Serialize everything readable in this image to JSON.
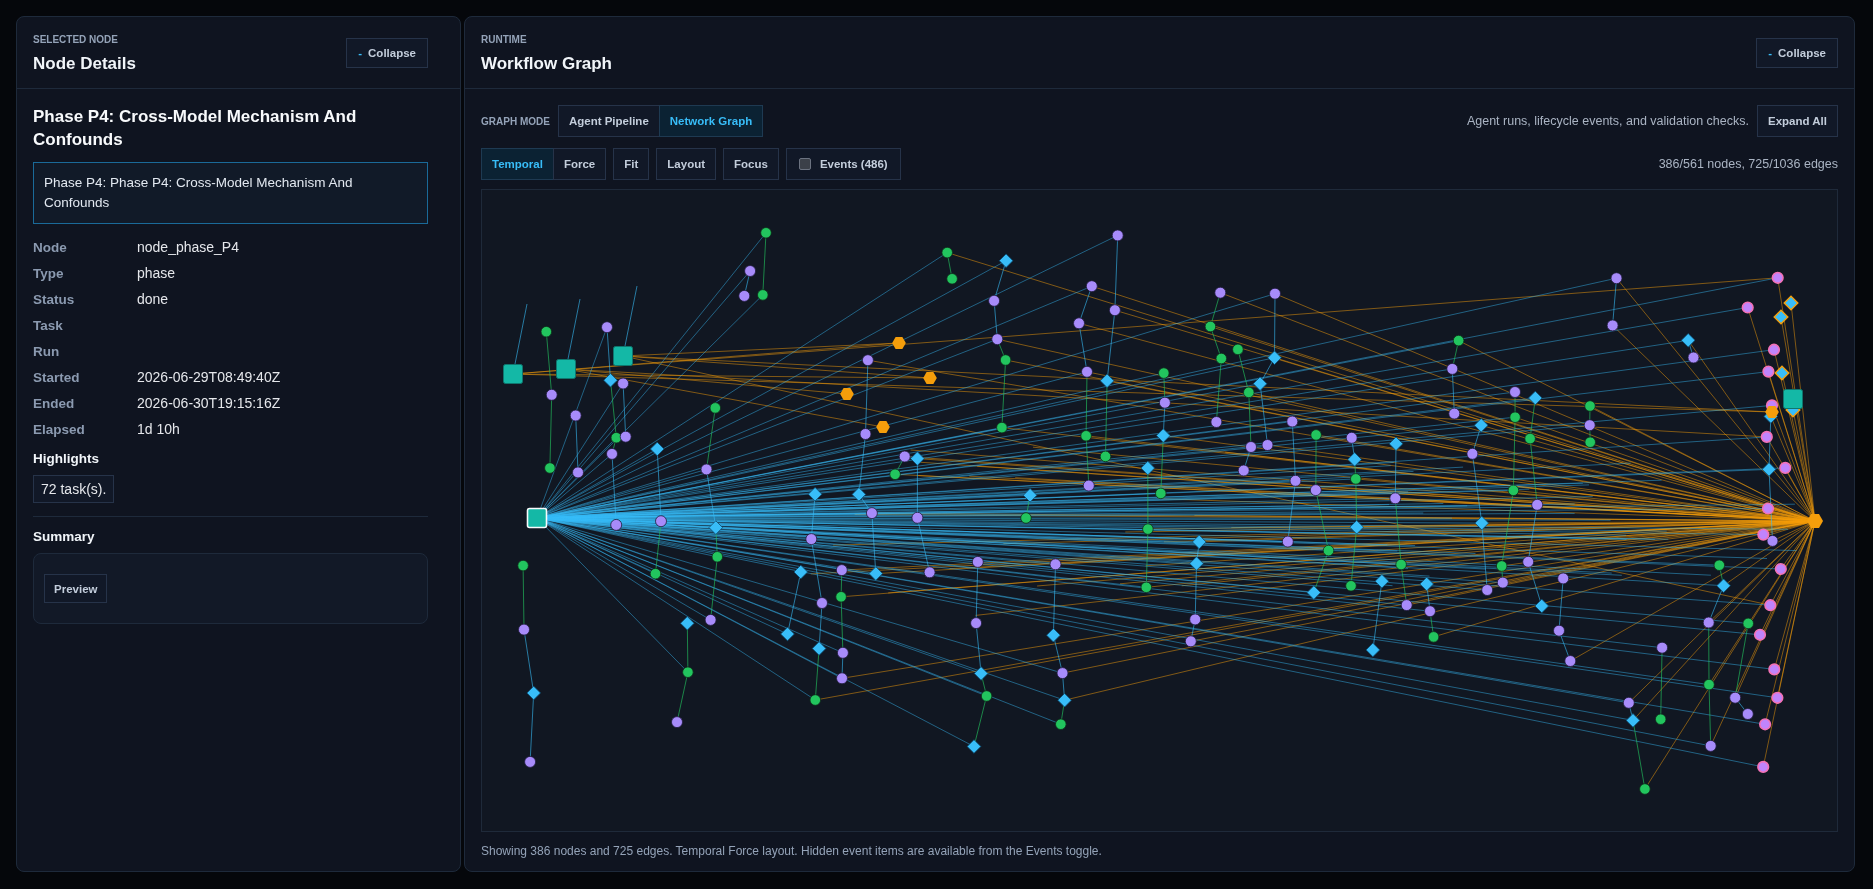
{
  "details_panel": {
    "eyebrow": "SELECTED NODE",
    "title": "Node Details",
    "collapse_button": {
      "icon": "-",
      "label": "Collapse"
    },
    "node_title": "Phase P4: Cross-Model Mechanism And Confounds",
    "description": "Phase P4: Phase P4: Cross-Model Mechanism And Confounds",
    "fields": [
      {
        "label": "Node",
        "value": "node_phase_P4"
      },
      {
        "label": "Type",
        "value": "phase"
      },
      {
        "label": "Status",
        "value": "done"
      },
      {
        "label": "Task"
      },
      {
        "label": "Run"
      },
      {
        "label": "Started",
        "value": "2026-06-29T08:49:40Z"
      },
      {
        "label": "Ended",
        "value": "2026-06-30T19:15:16Z"
      },
      {
        "label": "Elapsed",
        "value": "1d 10h"
      }
    ],
    "highlights": {
      "heading": "Highlights",
      "items": [
        "72 task(s)."
      ]
    },
    "summary": {
      "heading": "Summary",
      "button": "Preview"
    }
  },
  "graph_panel": {
    "eyebrow": "RUNTIME",
    "title": "Workflow Graph",
    "collapse_button": {
      "icon": "-",
      "label": "Collapse"
    },
    "mode_label": "GRAPH MODE",
    "modes": [
      {
        "label": "Agent Pipeline",
        "selected": false
      },
      {
        "label": "Network Graph",
        "selected": true
      }
    ],
    "description": "Agent runs, lifecycle events, and validation checks.",
    "expand_button": "Expand All",
    "layouts": [
      {
        "label": "Temporal",
        "selected": true
      },
      {
        "label": "Force",
        "selected": false
      }
    ],
    "tools": [
      "Fit",
      "Layout",
      "Focus"
    ],
    "events_toggle": {
      "label": "Events (486)",
      "checked": false
    },
    "counts": "386/561 nodes, 725/1036 edges",
    "footer": "Showing 386 nodes and 725 edges. Temporal Force layout. Hidden event items are available from the Events toggle."
  }
}
